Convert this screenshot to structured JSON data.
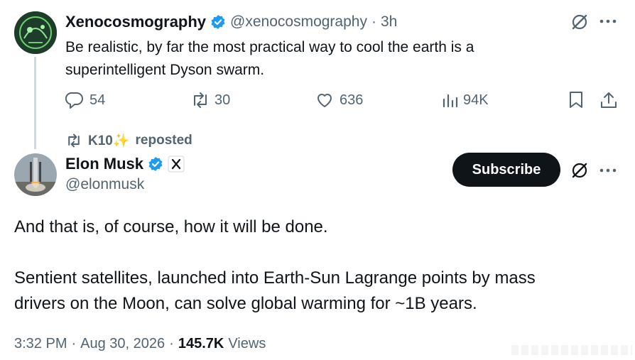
{
  "quoted_tweet": {
    "author_name": "Xenocosmography",
    "handle": "@xenocosmography",
    "separator": "·",
    "time": "3h",
    "text_line1": "Be realistic, by far the most practical way to cool the earth is a",
    "text_line2": "superintelligent Dyson swarm.",
    "replies": "54",
    "reposts": "30",
    "likes": "636",
    "views": "94K"
  },
  "repost_banner": {
    "name": "K10✨",
    "action": "reposted"
  },
  "main_tweet": {
    "author_name": "Elon Musk",
    "handle": "@elonmusk",
    "subscribe_label": "Subscribe",
    "text_line1": "And that is, of course, how it will be done.",
    "text_line2": "Sentient satellites, launched into Earth-Sun Lagrange points by mass",
    "text_line3": "drivers on the Moon, can solve global warming for ~1B years.",
    "time": "3:32 PM",
    "date": "Aug 30, 2026",
    "separator": "·",
    "views_count": "145.7K",
    "views_label": "Views"
  },
  "colors": {
    "verified_badge": "#1d9bf0",
    "text_primary": "#0f1419",
    "text_secondary": "#536471",
    "thread_line": "#cfd9de",
    "avatar_green": "#2f5d3a"
  },
  "icons": [
    "verified-icon",
    "grok-icon",
    "more-icon",
    "reply-icon",
    "repost-icon",
    "like-icon",
    "views-icon",
    "bookmark-icon",
    "share-icon",
    "x-logo-icon",
    "sparkle-icon"
  ]
}
